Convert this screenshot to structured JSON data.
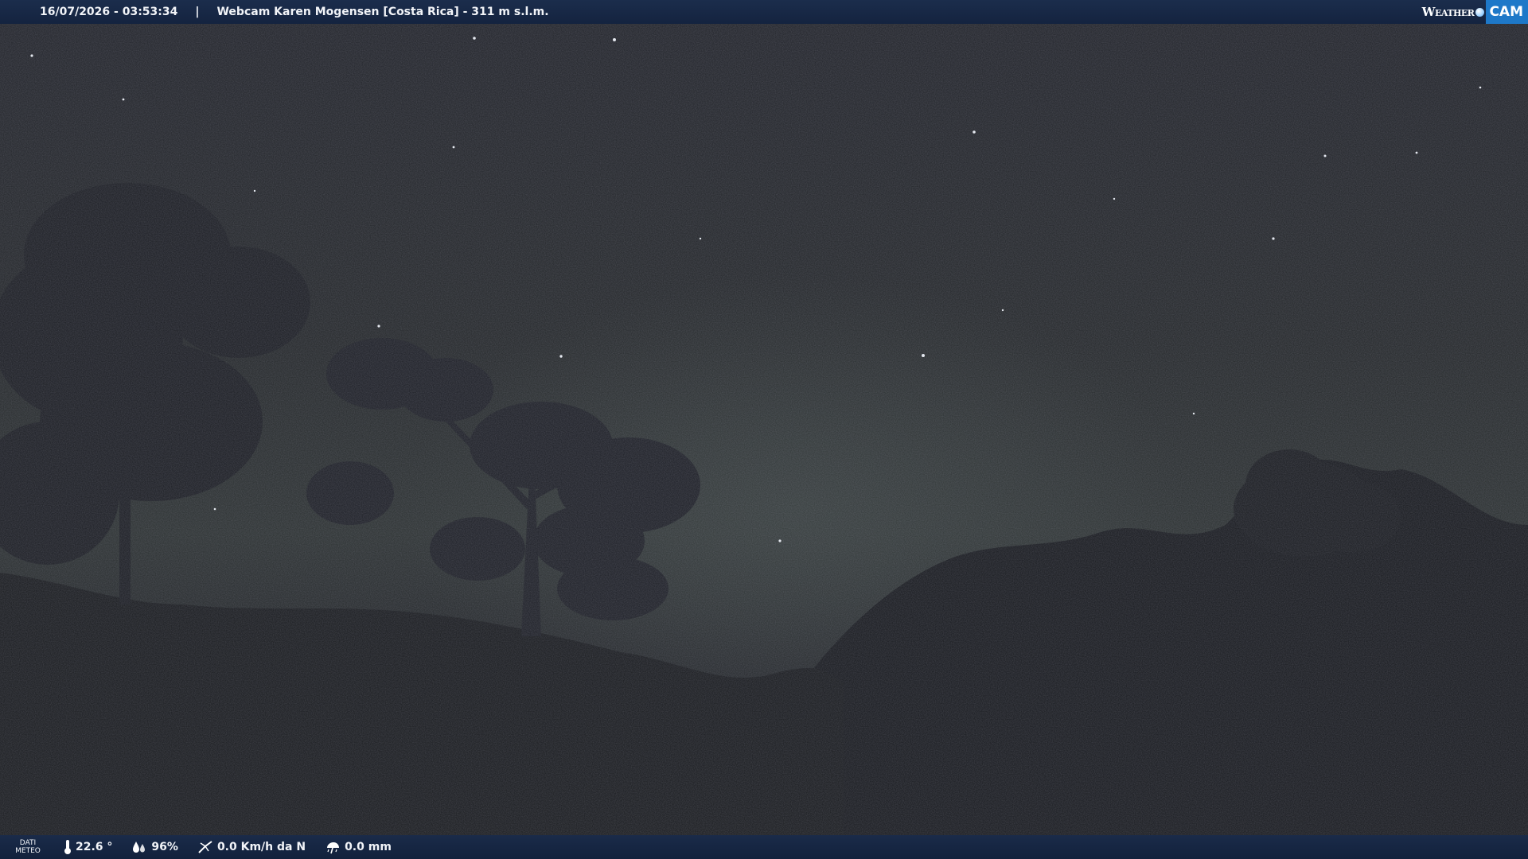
{
  "header": {
    "timestamp": "16/07/2026 - 03:53:34",
    "separator": "|",
    "title": "Webcam Karen Mogensen [Costa Rica] - 311 m s.l.m.",
    "brand_weather": "Weather",
    "brand_cam": "CAM"
  },
  "footer": {
    "label_line1": "DATI",
    "label_line2": "METEO",
    "temperature": "22.6 °",
    "humidity": "96%",
    "wind": "0.0 Km/h da N",
    "rain": "0.0 mm"
  },
  "icons": {
    "temperature": "thermometer-icon",
    "humidity": "humidity-drops-icon",
    "wind": "wind-vane-icon",
    "rain": "rain-gauge-icon"
  },
  "colors": {
    "bar_background": "#14233f",
    "brand_accent": "#1e78c8",
    "text": "#f2f4f8"
  }
}
